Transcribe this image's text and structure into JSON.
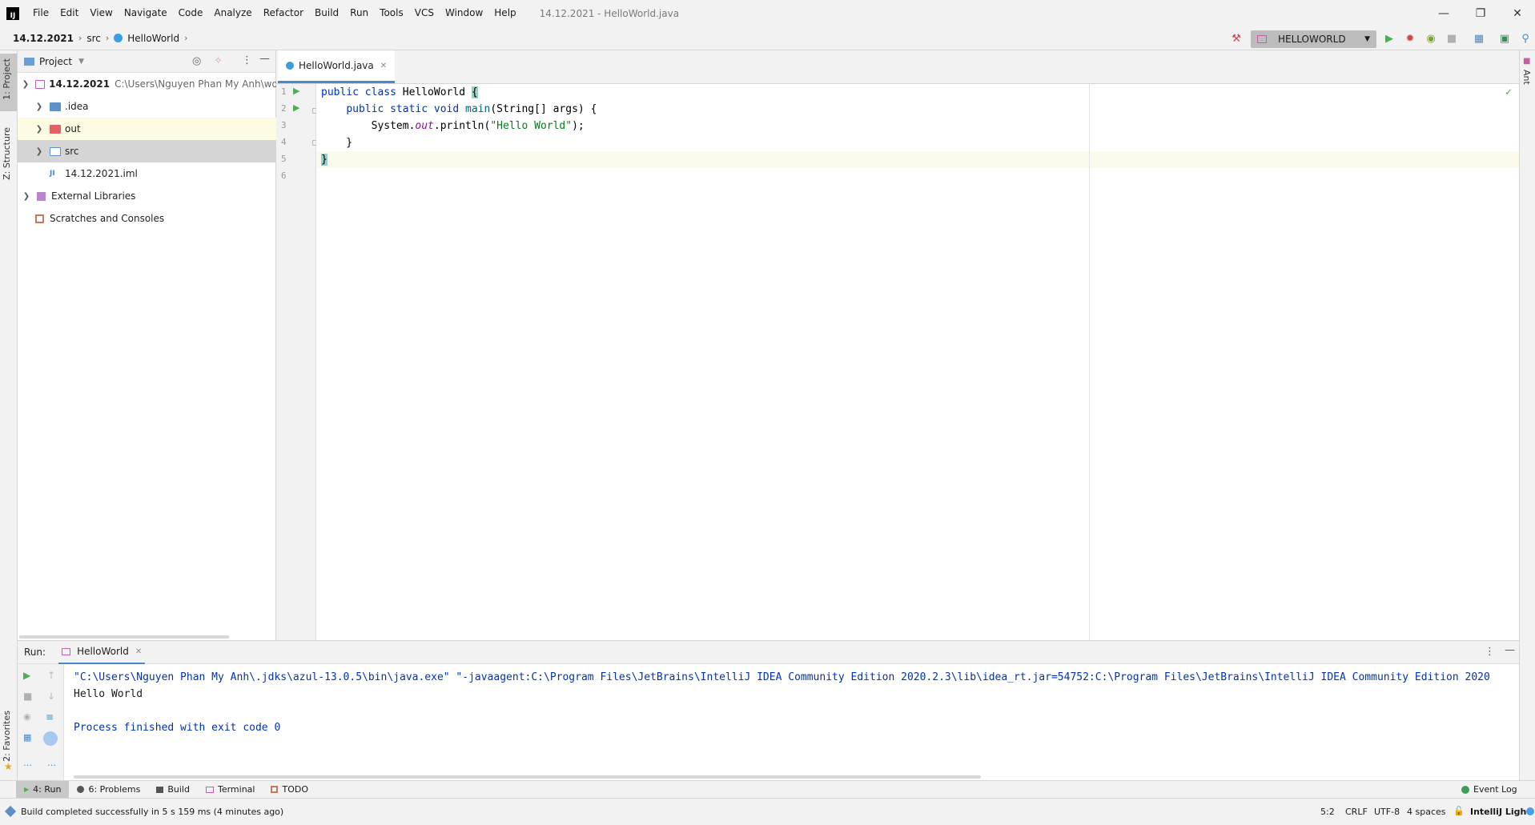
{
  "titlebar": {
    "logo": "IJ",
    "menu": [
      "File",
      "Edit",
      "View",
      "Navigate",
      "Code",
      "Analyze",
      "Refactor",
      "Build",
      "Run",
      "Tools",
      "VCS",
      "Window",
      "Help"
    ],
    "window_title": "14.12.2021 - HelloWorld.java"
  },
  "navbar": {
    "crumbs": [
      "14.12.2021",
      "src",
      "HelloWorld"
    ],
    "run_config": "HELLOWORLD"
  },
  "sidebar_left": {
    "project_tab": "1: Project",
    "structure_tab": "Z: Structure",
    "favorites_tab": "2: Favorites"
  },
  "sidebar_right": {
    "ant_tab": "Ant"
  },
  "project": {
    "header": "Project",
    "root_name": "14.12.2021",
    "root_path": "C:\\Users\\Nguyen Phan My Anh\\workspa",
    "items": [
      {
        "label": ".idea"
      },
      {
        "label": "out"
      },
      {
        "label": "src"
      },
      {
        "label": "14.12.2021.iml"
      },
      {
        "label": "External Libraries"
      },
      {
        "label": "Scratches and Consoles"
      }
    ]
  },
  "editor": {
    "tab_label": "HelloWorld.java",
    "line_numbers": [
      "1",
      "2",
      "3",
      "4",
      "5",
      "6"
    ]
  },
  "run": {
    "label": "Run:",
    "tab": "HelloWorld",
    "cmd": "\"C:\\Users\\Nguyen Phan My Anh\\.jdks\\azul-13.0.5\\bin\\java.exe\" \"-javaagent:C:\\Program Files\\JetBrains\\IntelliJ IDEA Community Edition 2020.2.3\\lib\\idea_rt.jar=54752:C:\\Program Files\\JetBrains\\IntelliJ IDEA Community Edition 2020",
    "output": "Hello World",
    "exit": "Process finished with exit code 0"
  },
  "bottom_tabs": {
    "run": "4: Run",
    "problems": "6: Problems",
    "build": "Build",
    "terminal": "Terminal",
    "todo": "TODO",
    "event_log": "Event Log"
  },
  "status": {
    "message": "Build completed successfully in 5 s 159 ms (4 minutes ago)",
    "position": "5:2",
    "line_sep": "CRLF",
    "encoding": "UTF-8",
    "indent": "4 spaces",
    "theme": "IntelliJ Light"
  }
}
